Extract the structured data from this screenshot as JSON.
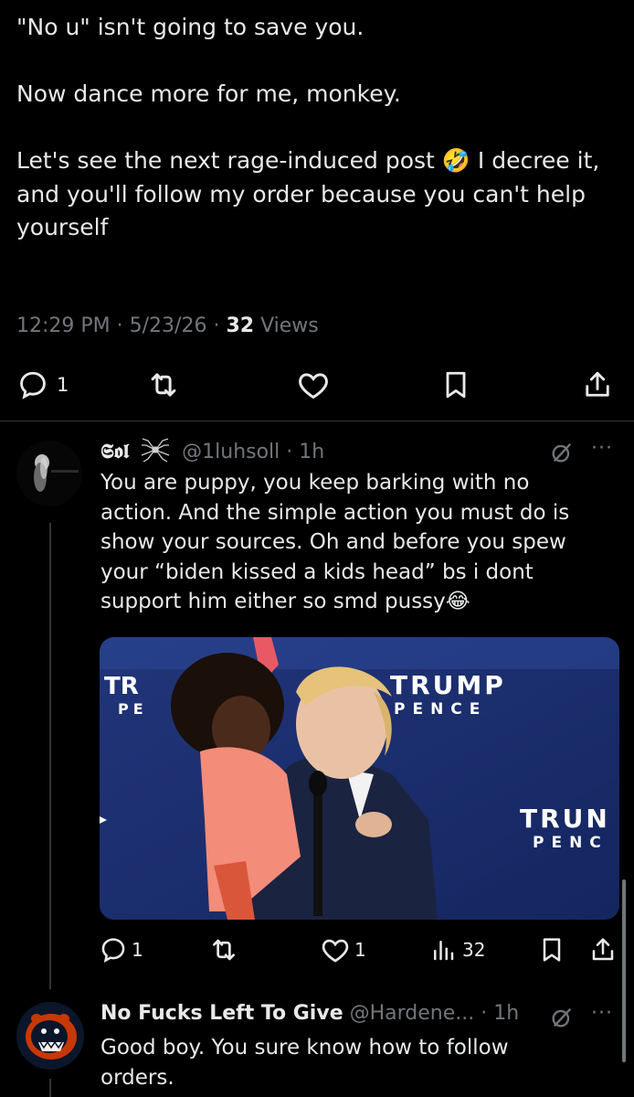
{
  "post": {
    "text": "\"No u\" isn't going to save you.\n\nNow dance more for me, monkey.\n\nLet's see the next rage-induced post 🤣 I decree it, and you'll follow my order because you can't help yourself",
    "time": "12:29 PM",
    "date": "5/23/26",
    "views_count": "32",
    "views_label": "Views",
    "actions": {
      "replies": "1"
    }
  },
  "reply1": {
    "display_name": "𝕾𝖔𝖑",
    "handle": "@1luhsoll",
    "time": "1h",
    "text": "You are puppy, you keep barking with no action. And the simple action you must do is show your sources. Oh and before you spew your “biden kissed a kids head” bs i dont support him either so smd pussy😂",
    "media": {
      "sign_left_1": "TR",
      "sign_left_2": "PE",
      "sign_center_1": "TRUMP",
      "sign_center_2": "PENCE",
      "sign_right_1": "TRUN",
      "sign_right_2": "PENC"
    },
    "actions": {
      "replies": "1",
      "likes": "1",
      "views": "32"
    }
  },
  "reply2": {
    "display_name": "No Fucks Left To Give",
    "handle": "@Hardene...",
    "time": "1h",
    "text": "Good boy. You sure know how to follow orders."
  },
  "colors": {
    "background": "#000000",
    "text": "#e7e9ea",
    "muted": "#71767b",
    "divider": "#2f3336",
    "bears_orange": "#c83803",
    "bears_navy": "#0b162a"
  }
}
